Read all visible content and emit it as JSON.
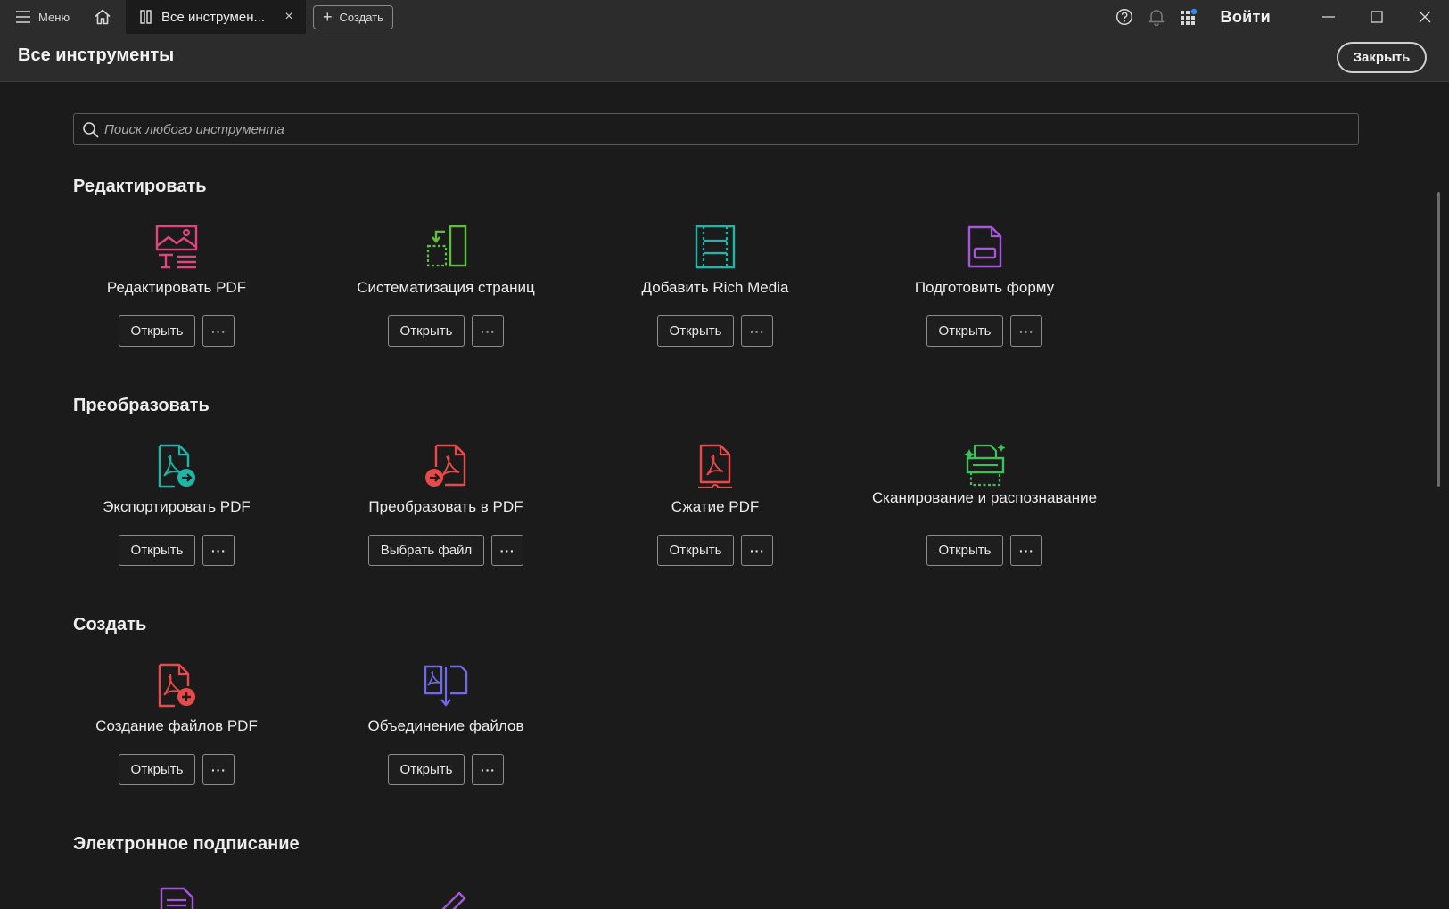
{
  "topbar": {
    "menu_label": "Меню",
    "tab_label": "Все инструмен...",
    "tab_close": "×",
    "create_label": "Создать",
    "signin_label": "Войти"
  },
  "header": {
    "title": "Все инструменты",
    "close_label": "Закрыть"
  },
  "search": {
    "placeholder": "Поиск любого инструмента"
  },
  "sections": [
    {
      "title": "Редактировать",
      "tools": [
        {
          "name": "Редактировать PDF",
          "primary": "Открыть",
          "more": "···",
          "icon": "edit-pdf-icon",
          "color": "#e0457e"
        },
        {
          "name": "Систематизация страниц",
          "primary": "Открыть",
          "more": "···",
          "icon": "organize-pages-icon",
          "color": "#5fbf3c"
        },
        {
          "name": "Добавить Rich Media",
          "primary": "Открыть",
          "more": "···",
          "icon": "rich-media-icon",
          "color": "#1fb5a8"
        },
        {
          "name": "Подготовить форму",
          "primary": "Открыть",
          "more": "···",
          "icon": "prepare-form-icon",
          "color": "#a557d8"
        }
      ]
    },
    {
      "title": "Преобразовать",
      "tools": [
        {
          "name": "Экспортировать PDF",
          "primary": "Открыть",
          "more": "···",
          "icon": "export-pdf-icon",
          "color": "#1fb5a8"
        },
        {
          "name": "Преобразовать в PDF",
          "primary": "Выбрать файл",
          "more": "···",
          "icon": "convert-to-pdf-icon",
          "color": "#e84a4a"
        },
        {
          "name": "Сжатие PDF",
          "primary": "Открыть",
          "more": "···",
          "icon": "compress-pdf-icon",
          "color": "#e84a4a"
        },
        {
          "name": "Сканирование и распознавание",
          "primary": "Открыть",
          "more": "···",
          "icon": "scan-ocr-icon",
          "color": "#3fbf5a"
        }
      ]
    },
    {
      "title": "Создать",
      "tools": [
        {
          "name": "Создание файлов PDF",
          "primary": "Открыть",
          "more": "···",
          "icon": "create-pdf-icon",
          "color": "#e84a4a"
        },
        {
          "name": "Объединение файлов",
          "primary": "Открыть",
          "more": "···",
          "icon": "combine-files-icon",
          "color": "#6f6ae6"
        }
      ]
    },
    {
      "title": "Электронное подписание",
      "tools": []
    }
  ]
}
